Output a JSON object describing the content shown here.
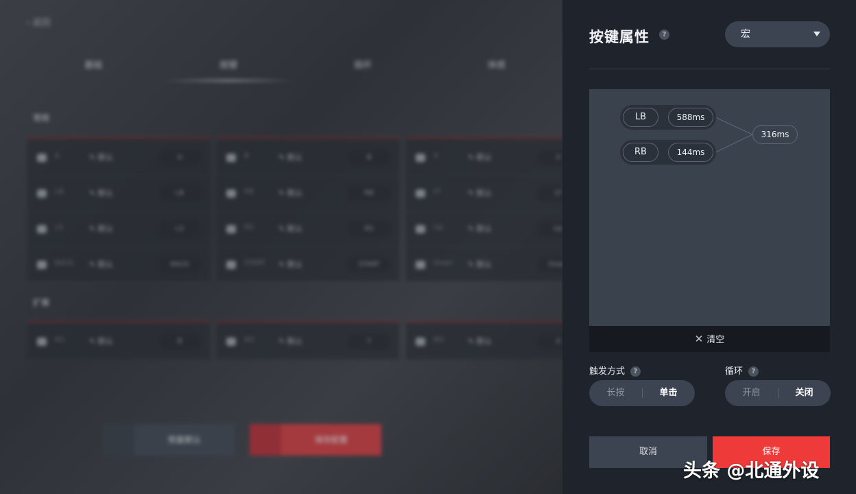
{
  "background": {
    "back_label": "返回",
    "tabs": [
      "基础",
      "按键",
      "摇杆",
      "体感"
    ],
    "section_normal": "常规",
    "section_extend": "扩展",
    "edit_label": "默认",
    "panels": [
      {
        "rows": [
          {
            "name": "A",
            "value": "A"
          },
          {
            "name": "LB",
            "value": "LB"
          },
          {
            "name": "LS",
            "value": "LS"
          },
          {
            "name": "BACK",
            "value": "BACK"
          }
        ]
      },
      {
        "rows": [
          {
            "name": "B",
            "value": "B"
          },
          {
            "name": "RB",
            "value": "RB"
          },
          {
            "name": "RS",
            "value": "RS"
          },
          {
            "name": "START",
            "value": "START"
          }
        ]
      },
      {
        "rows": [
          {
            "name": "X",
            "value": "X"
          },
          {
            "name": "LT",
            "value": "LT"
          },
          {
            "name": "Up",
            "value": "Up"
          },
          {
            "name": "Down",
            "value": "Down"
          }
        ]
      }
    ],
    "extend_panels": [
      {
        "name": "M1",
        "value": "B"
      },
      {
        "name": "M2",
        "value": "Y"
      },
      {
        "name": "M3",
        "value": "A"
      }
    ],
    "reset_button": "恢复默认",
    "apply_button": "保存配置"
  },
  "panel": {
    "title": "按键属性",
    "help_glyph": "?",
    "type_select": {
      "value": "宏"
    },
    "macro": {
      "steps": [
        {
          "key": "LB",
          "duration": "588ms"
        },
        {
          "key": "RB",
          "duration": "144ms"
        }
      ],
      "delay": "316ms"
    },
    "clear_label": "清空",
    "trigger": {
      "label": "触发方式",
      "options": [
        "长按",
        "单击"
      ],
      "selected": "单击"
    },
    "loop": {
      "label": "循环",
      "options": [
        "开启",
        "关闭"
      ],
      "selected": "关闭"
    },
    "cancel_label": "取消",
    "save_label": "保存"
  },
  "watermark": "头条 @北通外设",
  "colors": {
    "panel_bg": "#1f242c",
    "canvas_bg": "#3a424e",
    "control_bg": "#3b4450",
    "save_red": "#ef3a3a"
  }
}
